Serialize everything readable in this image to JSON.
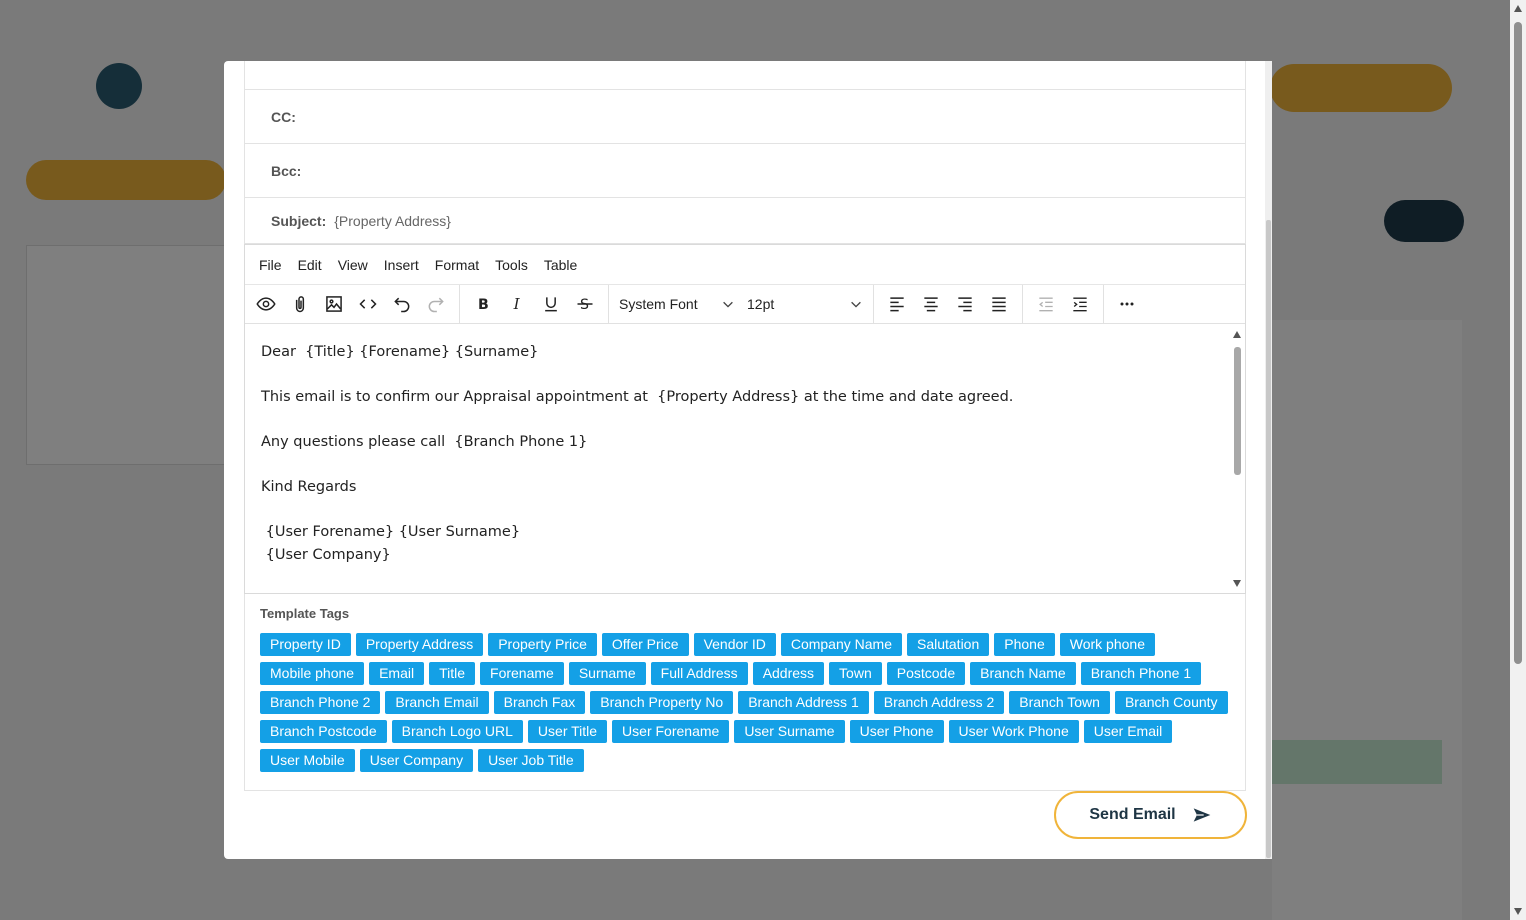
{
  "email": {
    "cc_label": "CC:",
    "cc_value": "",
    "bcc_label": "Bcc:",
    "bcc_value": "",
    "subject_label": "Subject:",
    "subject_value": "{Property Address}"
  },
  "editor": {
    "menu": [
      "File",
      "Edit",
      "View",
      "Insert",
      "Format",
      "Tools",
      "Table"
    ],
    "font_family": "System Font",
    "font_size": "12pt",
    "toolbar_icons": [
      "preview-icon",
      "attachment-icon",
      "image-icon",
      "code-icon",
      "undo-icon",
      "redo-icon",
      "bold-icon",
      "italic-icon",
      "underline-icon",
      "strikethrough-icon",
      "align-left-icon",
      "align-center-icon",
      "align-right-icon",
      "justify-icon",
      "outdent-icon",
      "indent-icon",
      "more-icon"
    ],
    "body": {
      "line1": "Dear  {Title} {Forename} {Surname}",
      "line2": "This email is to confirm our Appraisal appointment at  {Property Address} at the time and date agreed.",
      "line3": "Any questions please call  {Branch Phone 1}",
      "line4": "Kind Regards",
      "line5": " {User Forename} {User Surname}",
      "line6": " {User Company}"
    }
  },
  "template_tags": {
    "title": "Template Tags",
    "tags": [
      "Property ID",
      "Property Address",
      "Property Price",
      "Offer Price",
      "Vendor ID",
      "Company Name",
      "Salutation",
      "Phone",
      "Work phone",
      "Mobile phone",
      "Email",
      "Title",
      "Forename",
      "Surname",
      "Full Address",
      "Address",
      "Town",
      "Postcode",
      "Branch Name",
      "Branch Phone 1",
      "Branch Phone 2",
      "Branch Email",
      "Branch Fax",
      "Branch Property No",
      "Branch Address 1",
      "Branch Address 2",
      "Branch Town",
      "Branch County",
      "Branch Postcode",
      "Branch Logo URL",
      "User Title",
      "User Forename",
      "User Surname",
      "User Phone",
      "User Work Phone",
      "User Email",
      "User Mobile",
      "User Company",
      "User Job Title"
    ]
  },
  "actions": {
    "send_label": "Send Email"
  },
  "colors": {
    "tag_bg": "#14a0e6",
    "accent": "#f0b43a",
    "button_text": "#1e3544"
  }
}
